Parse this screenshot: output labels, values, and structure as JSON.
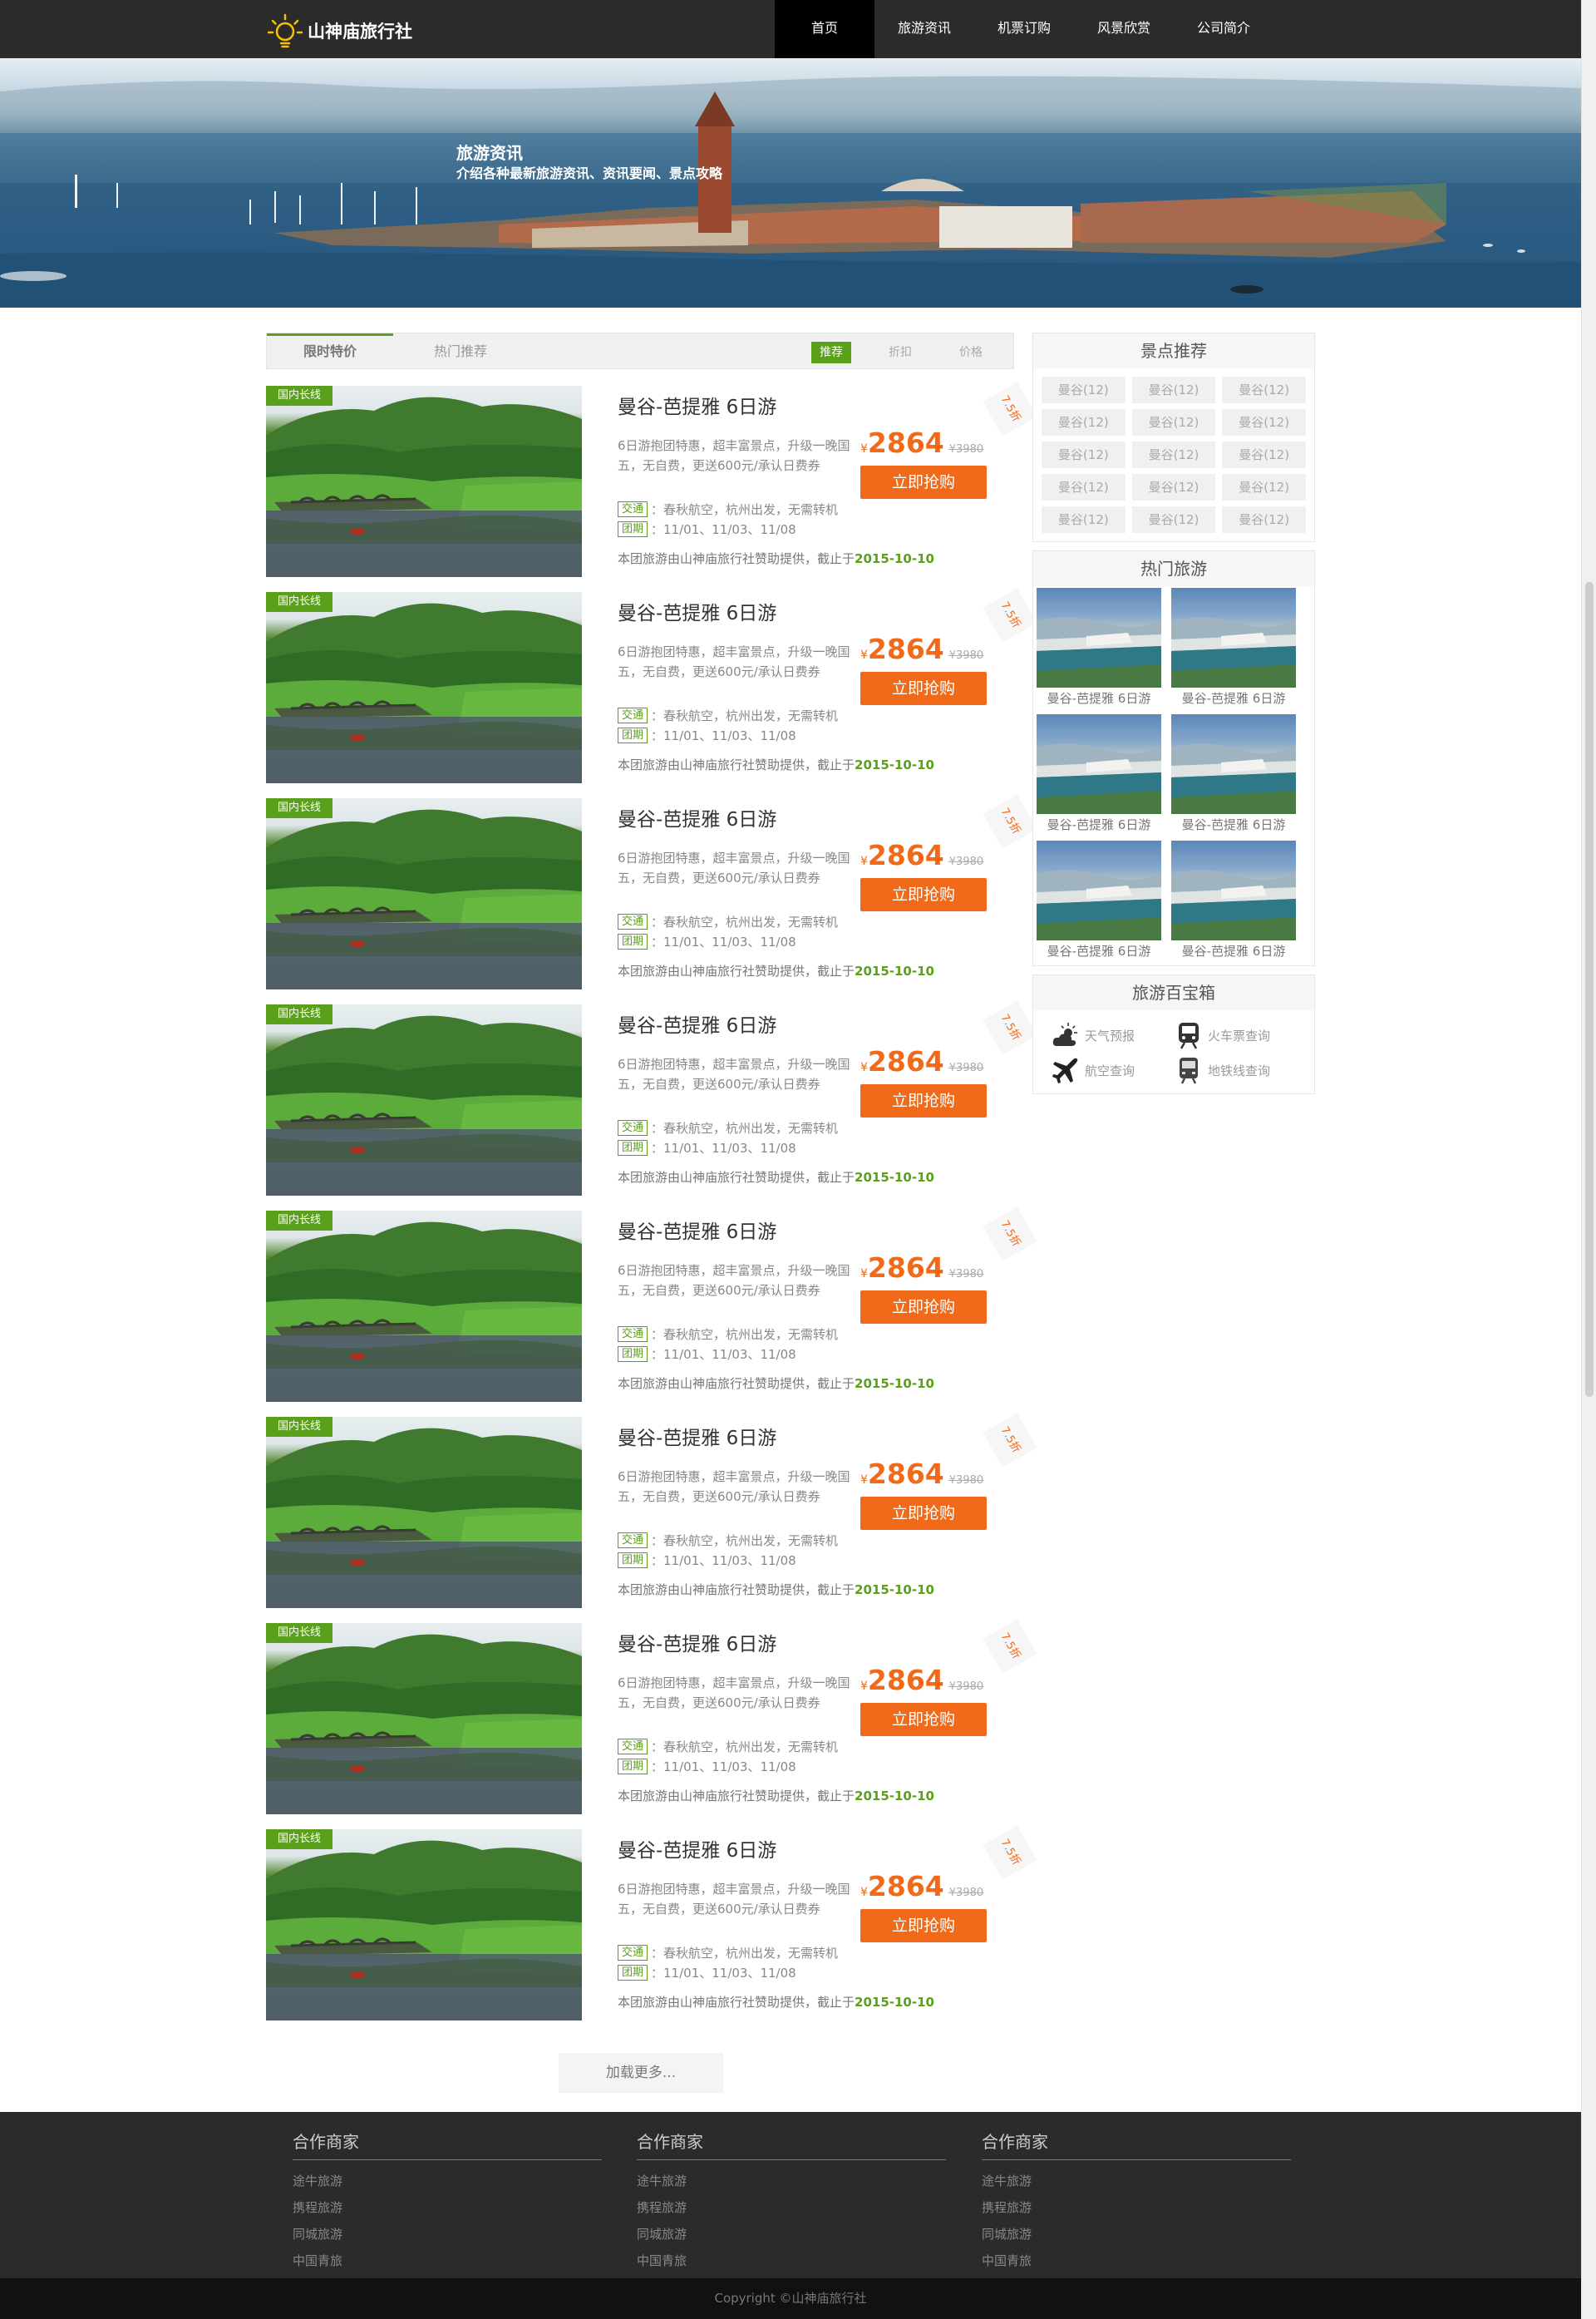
{
  "header": {
    "site_name": "山神庙旅行社",
    "nav": [
      "首页",
      "旅游资讯",
      "机票订购",
      "风景欣赏",
      "公司简介"
    ]
  },
  "banner": {
    "title": "旅游资讯",
    "subtitle": "介绍各种最新旅游资讯、资讯要闻、景点攻略"
  },
  "tabs": {
    "left": [
      "限时特价",
      "热门推荐"
    ],
    "sort": [
      "推荐",
      "折扣",
      "价格"
    ]
  },
  "products": [
    {
      "badge": "国内长线",
      "title": "曼谷-芭提雅 6日游",
      "desc": "6日游抱团特惠，超丰富景点，升级一晚国五，无自费，更送600元/承认日费券",
      "transport_tag": "交通",
      "transport": "：春秋航空，杭州出发，无需转机",
      "group_tag": "团期",
      "group": "：11/01、11/03、11/08",
      "sponsor": "本团旅游由山神庙旅行社赞助提供，截止于",
      "deadline": "2015-10-10",
      "currency": "¥",
      "price": "2864",
      "old_price": "¥3980",
      "buy": "立即抢购",
      "discount": "7.5折"
    },
    {
      "badge": "国内长线",
      "title": "曼谷-芭提雅 6日游",
      "desc": "6日游抱团特惠，超丰富景点，升级一晚国五，无自费，更送600元/承认日费券",
      "transport_tag": "交通",
      "transport": "：春秋航空，杭州出发，无需转机",
      "group_tag": "团期",
      "group": "：11/01、11/03、11/08",
      "sponsor": "本团旅游由山神庙旅行社赞助提供，截止于",
      "deadline": "2015-10-10",
      "currency": "¥",
      "price": "2864",
      "old_price": "¥3980",
      "buy": "立即抢购",
      "discount": "7.5折"
    },
    {
      "badge": "国内长线",
      "title": "曼谷-芭提雅 6日游",
      "desc": "6日游抱团特惠，超丰富景点，升级一晚国五，无自费，更送600元/承认日费券",
      "transport_tag": "交通",
      "transport": "：春秋航空，杭州出发，无需转机",
      "group_tag": "团期",
      "group": "：11/01、11/03、11/08",
      "sponsor": "本团旅游由山神庙旅行社赞助提供，截止于",
      "deadline": "2015-10-10",
      "currency": "¥",
      "price": "2864",
      "old_price": "¥3980",
      "buy": "立即抢购",
      "discount": "7.5折"
    },
    {
      "badge": "国内长线",
      "title": "曼谷-芭提雅 6日游",
      "desc": "6日游抱团特惠，超丰富景点，升级一晚国五，无自费，更送600元/承认日费券",
      "transport_tag": "交通",
      "transport": "：春秋航空，杭州出发，无需转机",
      "group_tag": "团期",
      "group": "：11/01、11/03、11/08",
      "sponsor": "本团旅游由山神庙旅行社赞助提供，截止于",
      "deadline": "2015-10-10",
      "currency": "¥",
      "price": "2864",
      "old_price": "¥3980",
      "buy": "立即抢购",
      "discount": "7.5折"
    },
    {
      "badge": "国内长线",
      "title": "曼谷-芭提雅 6日游",
      "desc": "6日游抱团特惠，超丰富景点，升级一晚国五，无自费，更送600元/承认日费券",
      "transport_tag": "交通",
      "transport": "：春秋航空，杭州出发，无需转机",
      "group_tag": "团期",
      "group": "：11/01、11/03、11/08",
      "sponsor": "本团旅游由山神庙旅行社赞助提供，截止于",
      "deadline": "2015-10-10",
      "currency": "¥",
      "price": "2864",
      "old_price": "¥3980",
      "buy": "立即抢购",
      "discount": "7.5折"
    },
    {
      "badge": "国内长线",
      "title": "曼谷-芭提雅 6日游",
      "desc": "6日游抱团特惠，超丰富景点，升级一晚国五，无自费，更送600元/承认日费券",
      "transport_tag": "交通",
      "transport": "：春秋航空，杭州出发，无需转机",
      "group_tag": "团期",
      "group": "：11/01、11/03、11/08",
      "sponsor": "本团旅游由山神庙旅行社赞助提供，截止于",
      "deadline": "2015-10-10",
      "currency": "¥",
      "price": "2864",
      "old_price": "¥3980",
      "buy": "立即抢购",
      "discount": "7.5折"
    },
    {
      "badge": "国内长线",
      "title": "曼谷-芭提雅 6日游",
      "desc": "6日游抱团特惠，超丰富景点，升级一晚国五，无自费，更送600元/承认日费券",
      "transport_tag": "交通",
      "transport": "：春秋航空，杭州出发，无需转机",
      "group_tag": "团期",
      "group": "：11/01、11/03、11/08",
      "sponsor": "本团旅游由山神庙旅行社赞助提供，截止于",
      "deadline": "2015-10-10",
      "currency": "¥",
      "price": "2864",
      "old_price": "¥3980",
      "buy": "立即抢购",
      "discount": "7.5折"
    },
    {
      "badge": "国内长线",
      "title": "曼谷-芭提雅 6日游",
      "desc": "6日游抱团特惠，超丰富景点，升级一晚国五，无自费，更送600元/承认日费券",
      "transport_tag": "交通",
      "transport": "：春秋航空，杭州出发，无需转机",
      "group_tag": "团期",
      "group": "：11/01、11/03、11/08",
      "sponsor": "本团旅游由山神庙旅行社赞助提供，截止于",
      "deadline": "2015-10-10",
      "currency": "¥",
      "price": "2864",
      "old_price": "¥3980",
      "buy": "立即抢购",
      "discount": "7.5折"
    }
  ],
  "load_more": "加载更多...",
  "sidebar": {
    "spots_title": "景点推荐",
    "spots": [
      "曼谷(12)",
      "曼谷(12)",
      "曼谷(12)",
      "曼谷(12)",
      "曼谷(12)",
      "曼谷(12)",
      "曼谷(12)",
      "曼谷(12)",
      "曼谷(12)",
      "曼谷(12)",
      "曼谷(12)",
      "曼谷(12)",
      "曼谷(12)",
      "曼谷(12)",
      "曼谷(12)"
    ],
    "hot_title": "热门旅游",
    "hot": [
      "曼谷-芭提雅 6日游",
      "曼谷-芭提雅 6日游",
      "曼谷-芭提雅 6日游",
      "曼谷-芭提雅 6日游",
      "曼谷-芭提雅 6日游",
      "曼谷-芭提雅 6日游"
    ],
    "tools_title": "旅游百宝箱",
    "tools": [
      {
        "label": "天气预报",
        "icon": "weather-icon"
      },
      {
        "label": "火车票查询",
        "icon": "train-icon"
      },
      {
        "label": "航空查询",
        "icon": "plane-icon"
      },
      {
        "label": "地铁线查询",
        "icon": "subway-icon"
      }
    ]
  },
  "footer": {
    "columns": [
      {
        "title": "合作商家",
        "links": [
          "途牛旅游",
          "携程旅游",
          "同城旅游",
          "中国青旅"
        ]
      },
      {
        "title": "合作商家",
        "links": [
          "途牛旅游",
          "携程旅游",
          "同城旅游",
          "中国青旅"
        ]
      },
      {
        "title": "合作商家",
        "links": [
          "途牛旅游",
          "携程旅游",
          "同城旅游",
          "中国青旅"
        ]
      }
    ],
    "copyright": "Copyright ©山神庙旅行社"
  },
  "colors": {
    "accent_green": "#5aa01a",
    "accent_orange": "#f16a1a",
    "header_bg": "#2b2b2b"
  }
}
